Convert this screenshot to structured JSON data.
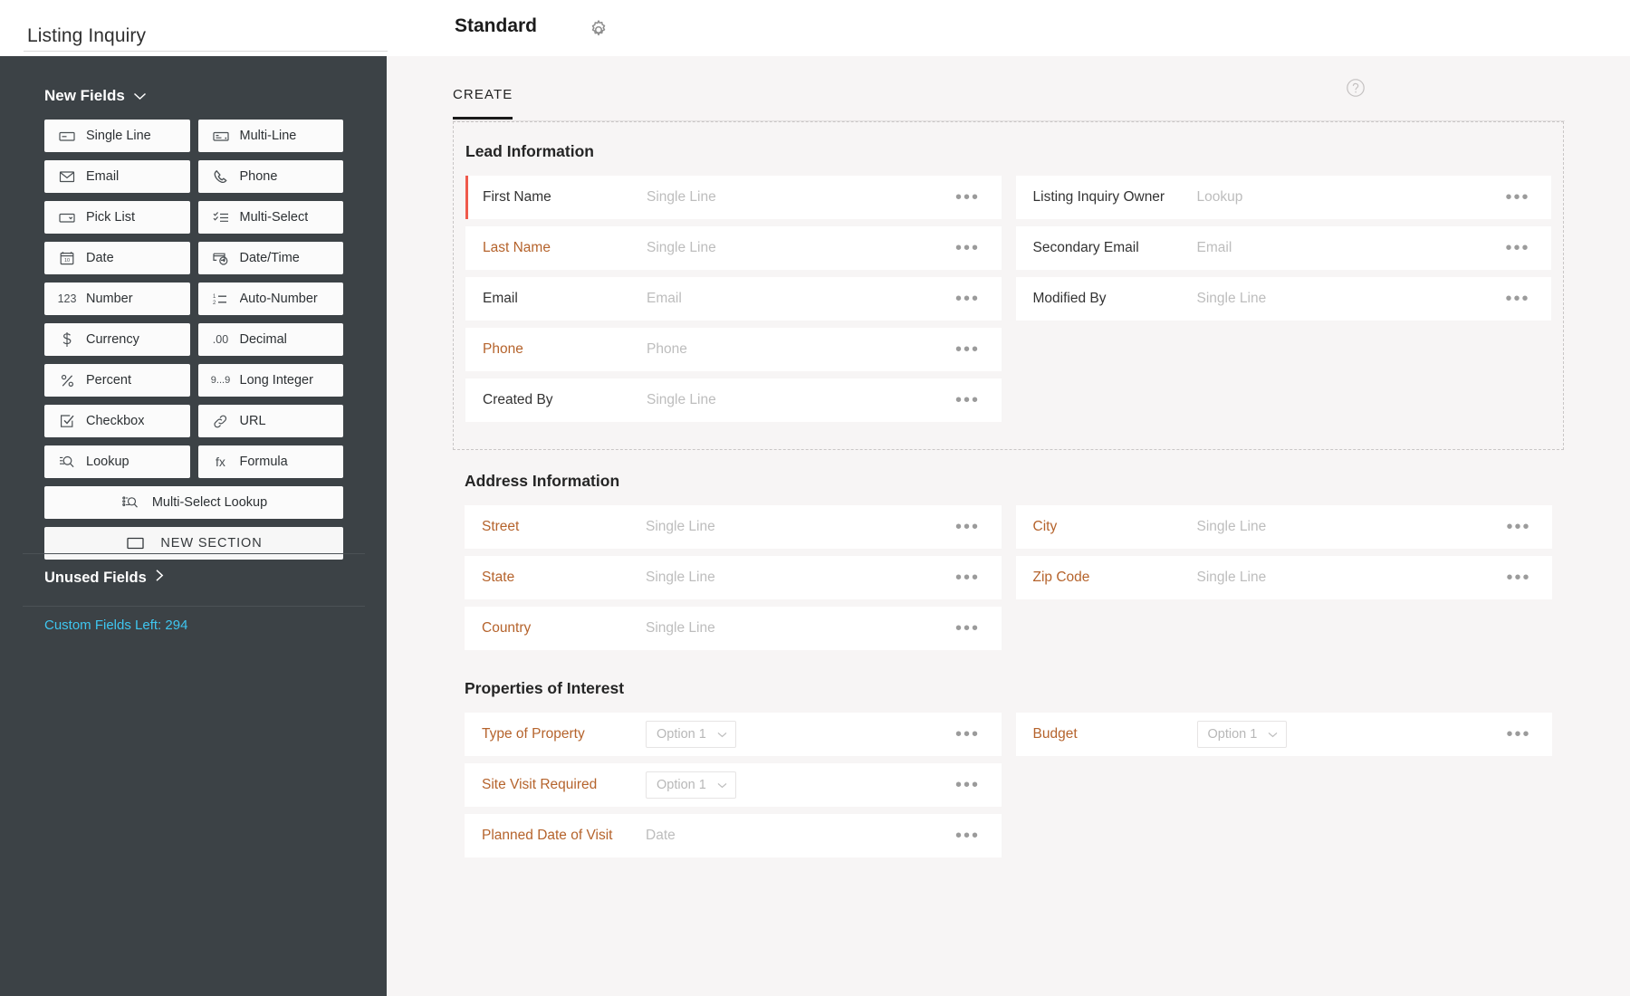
{
  "topbar": {
    "module_title": "Listing Inquiry",
    "layout_title": "Standard",
    "gear_icon": "gear-icon"
  },
  "sidebar": {
    "new_fields_label": "New Fields",
    "unused_fields_label": "Unused Fields",
    "custom_fields_left": "Custom Fields Left: 294",
    "accent_color": "#3ec6f0",
    "background_color": "#3c4246",
    "field_rows": [
      [
        {
          "label": "Single Line",
          "icon": "single-line-icon"
        },
        {
          "label": "Multi-Line",
          "icon": "multi-line-icon"
        }
      ],
      [
        {
          "label": "Email",
          "icon": "envelope-icon"
        },
        {
          "label": "Phone",
          "icon": "phone-icon"
        }
      ],
      [
        {
          "label": "Pick List",
          "icon": "pick-list-icon"
        },
        {
          "label": "Multi-Select",
          "icon": "multi-select-icon"
        }
      ],
      [
        {
          "label": "Date",
          "icon": "calendar-icon"
        },
        {
          "label": "Date/Time",
          "icon": "date-time-icon"
        }
      ],
      [
        {
          "label": "Number",
          "icon": "number-123-icon"
        },
        {
          "label": "Auto-Number",
          "icon": "auto-number-icon"
        }
      ],
      [
        {
          "label": "Currency",
          "icon": "dollar-icon"
        },
        {
          "label": "Decimal",
          "icon": "decimal-icon"
        }
      ],
      [
        {
          "label": "Percent",
          "icon": "percent-icon"
        },
        {
          "label": "Long Integer",
          "icon": "long-integer-icon"
        }
      ],
      [
        {
          "label": "Checkbox",
          "icon": "checkbox-icon"
        },
        {
          "label": "URL",
          "icon": "link-icon"
        }
      ],
      [
        {
          "label": "Lookup",
          "icon": "lookup-icon"
        },
        {
          "label": "Formula",
          "icon": "formula-fx-icon"
        }
      ]
    ],
    "multi_select_lookup": {
      "label": "Multi-Select Lookup",
      "icon": "multi-select-lookup-icon"
    },
    "new_section": {
      "label": "NEW SECTION",
      "icon": "section-rectangle-icon"
    }
  },
  "main": {
    "tab_label": "CREATE",
    "help_icon": "question-mark-icon",
    "required_marker_color": "#ef5a4c",
    "label_orange": "#b5632c",
    "sections": [
      {
        "title": "Lead Information",
        "boxed": true,
        "fields": [
          {
            "label": "First Name",
            "value": "Single Line",
            "type": "text",
            "required": true,
            "orange": false
          },
          {
            "label": "Listing Inquiry Owner",
            "value": "Lookup",
            "type": "text",
            "required": false,
            "orange": false
          },
          {
            "label": "Last Name",
            "value": "Single Line",
            "type": "text",
            "required": false,
            "orange": true
          },
          {
            "label": "Secondary Email",
            "value": "Email",
            "type": "text",
            "required": false,
            "orange": false
          },
          {
            "label": "Email",
            "value": "Email",
            "type": "text",
            "required": false,
            "orange": false
          },
          {
            "label": "Modified By",
            "value": "Single Line",
            "type": "text",
            "required": false,
            "orange": false
          },
          {
            "label": "Phone",
            "value": "Phone",
            "type": "text",
            "required": false,
            "orange": true
          },
          {
            "label": "",
            "value": "",
            "type": "empty",
            "required": false,
            "orange": false
          },
          {
            "label": "Created By",
            "value": "Single Line",
            "type": "text",
            "required": false,
            "orange": false
          },
          {
            "label": "",
            "value": "",
            "type": "empty",
            "required": false,
            "orange": false
          }
        ]
      },
      {
        "title": "Address Information",
        "boxed": false,
        "fields": [
          {
            "label": "Street",
            "value": "Single Line",
            "type": "text",
            "required": false,
            "orange": true
          },
          {
            "label": "City",
            "value": "Single Line",
            "type": "text",
            "required": false,
            "orange": true
          },
          {
            "label": "State",
            "value": "Single Line",
            "type": "text",
            "required": false,
            "orange": true
          },
          {
            "label": "Zip Code",
            "value": "Single Line",
            "type": "text",
            "required": false,
            "orange": true
          },
          {
            "label": "Country",
            "value": "Single Line",
            "type": "text",
            "required": false,
            "orange": true
          },
          {
            "label": "",
            "value": "",
            "type": "empty",
            "required": false,
            "orange": false
          }
        ]
      },
      {
        "title": "Properties of Interest",
        "boxed": false,
        "fields": [
          {
            "label": "Type of Property",
            "value": "Option 1",
            "type": "select",
            "required": false,
            "orange": true
          },
          {
            "label": "Budget",
            "value": "Option 1",
            "type": "select",
            "required": false,
            "orange": true
          },
          {
            "label": "Site Visit Required",
            "value": "Option 1",
            "type": "select",
            "required": false,
            "orange": true
          },
          {
            "label": "",
            "value": "",
            "type": "empty",
            "required": false,
            "orange": false
          },
          {
            "label": "Planned Date of Visit",
            "value": "Date",
            "type": "text",
            "required": false,
            "orange": true
          },
          {
            "label": "",
            "value": "",
            "type": "empty",
            "required": false,
            "orange": false
          }
        ]
      }
    ],
    "row_menu_glyph": "•••"
  }
}
